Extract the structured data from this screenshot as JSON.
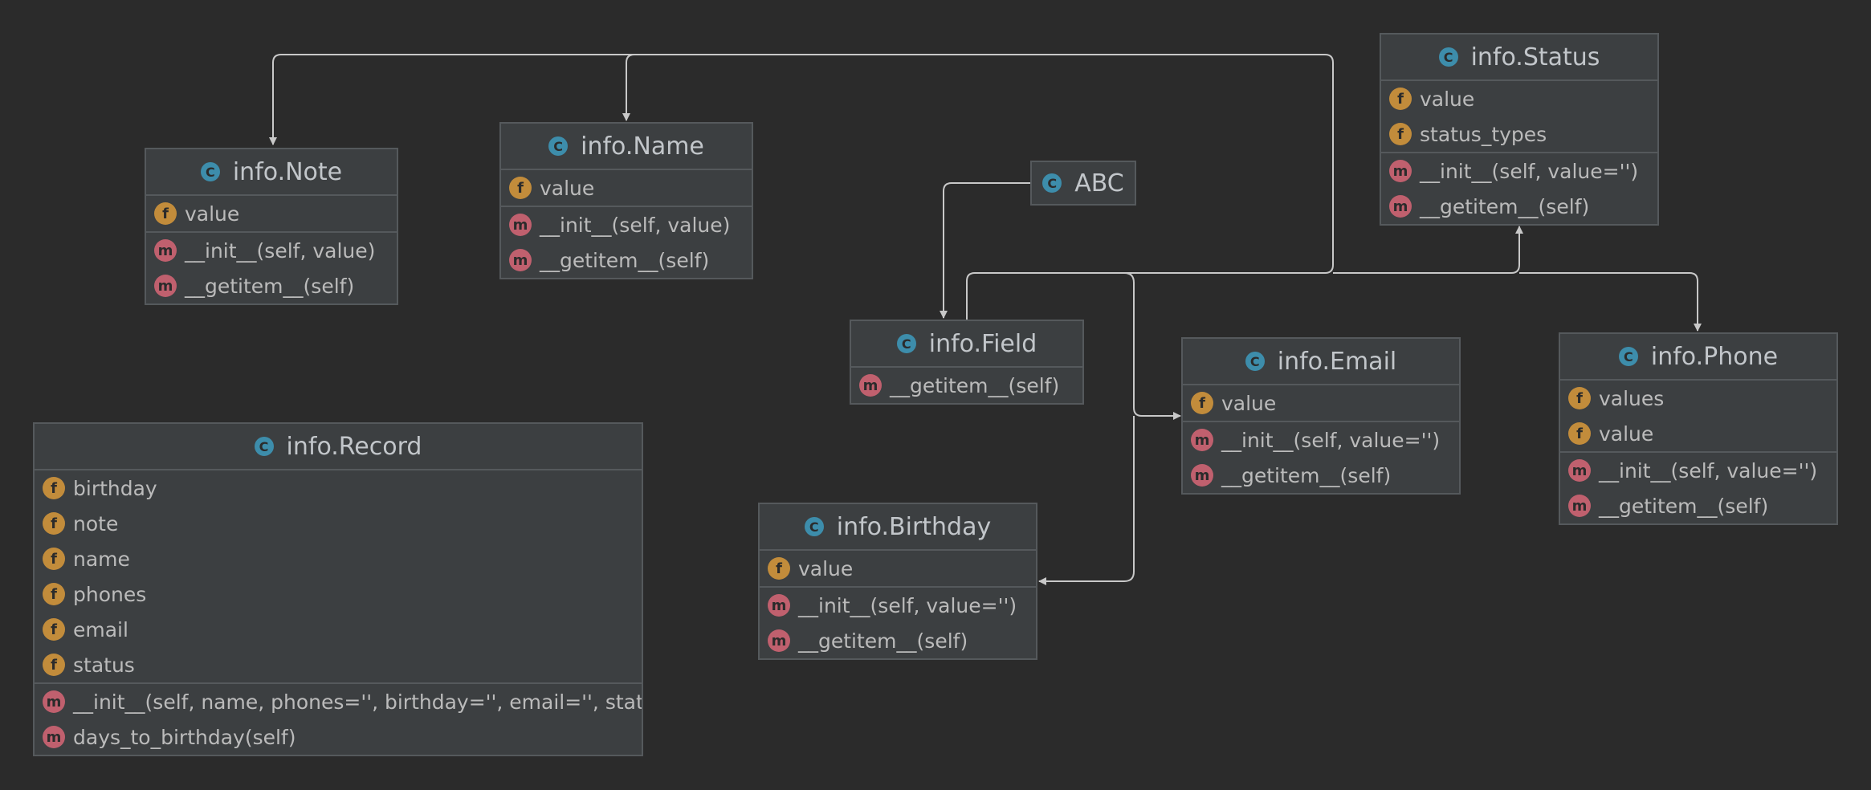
{
  "classes": {
    "note": {
      "name": "info.Note",
      "fields": [
        "value"
      ],
      "methods": [
        "__init__(self, value)",
        "__getitem__(self)"
      ]
    },
    "name": {
      "name": "info.Name",
      "fields": [
        "value"
      ],
      "methods": [
        "__init__(self, value)",
        "__getitem__(self)"
      ]
    },
    "abc": {
      "name": "ABC"
    },
    "status": {
      "name": "info.Status",
      "fields": [
        "value",
        "status_types"
      ],
      "methods": [
        "__init__(self, value='')",
        "__getitem__(self)"
      ]
    },
    "field": {
      "name": "info.Field",
      "methods": [
        "__getitem__(self)"
      ]
    },
    "email": {
      "name": "info.Email",
      "fields": [
        "value"
      ],
      "methods": [
        "__init__(self, value='')",
        "__getitem__(self)"
      ]
    },
    "phone": {
      "name": "info.Phone",
      "fields": [
        "values",
        "value"
      ],
      "methods": [
        "__init__(self, value='')",
        "__getitem__(self)"
      ]
    },
    "record": {
      "name": "info.Record",
      "fields": [
        "birthday",
        "note",
        "name",
        "phones",
        "email",
        "status"
      ],
      "methods": [
        "__init__(self, name, phones='', birthday='', email='', status='')",
        "days_to_birthday(self)"
      ]
    },
    "birthday": {
      "name": "info.Birthday",
      "fields": [
        "value"
      ],
      "methods": [
        "__init__(self, value='')",
        "__getitem__(self)"
      ]
    }
  },
  "icons": {
    "class": "C",
    "field": "f",
    "method": "m"
  },
  "relations": [
    {
      "from": "abc",
      "to": "field"
    },
    {
      "from": "field",
      "to": "note"
    },
    {
      "from": "field",
      "to": "name"
    },
    {
      "from": "field",
      "to": "status"
    },
    {
      "from": "field",
      "to": "phone"
    },
    {
      "from": "field",
      "to": "email"
    },
    {
      "from": "field",
      "to": "birthday"
    }
  ],
  "colors": {
    "background": "#2b2b2b",
    "node": "#3c3f41",
    "edge": "#c8c8c8",
    "class_icon": "#3d8dab",
    "field_icon": "#c28c3b",
    "method_icon": "#c0606e"
  }
}
